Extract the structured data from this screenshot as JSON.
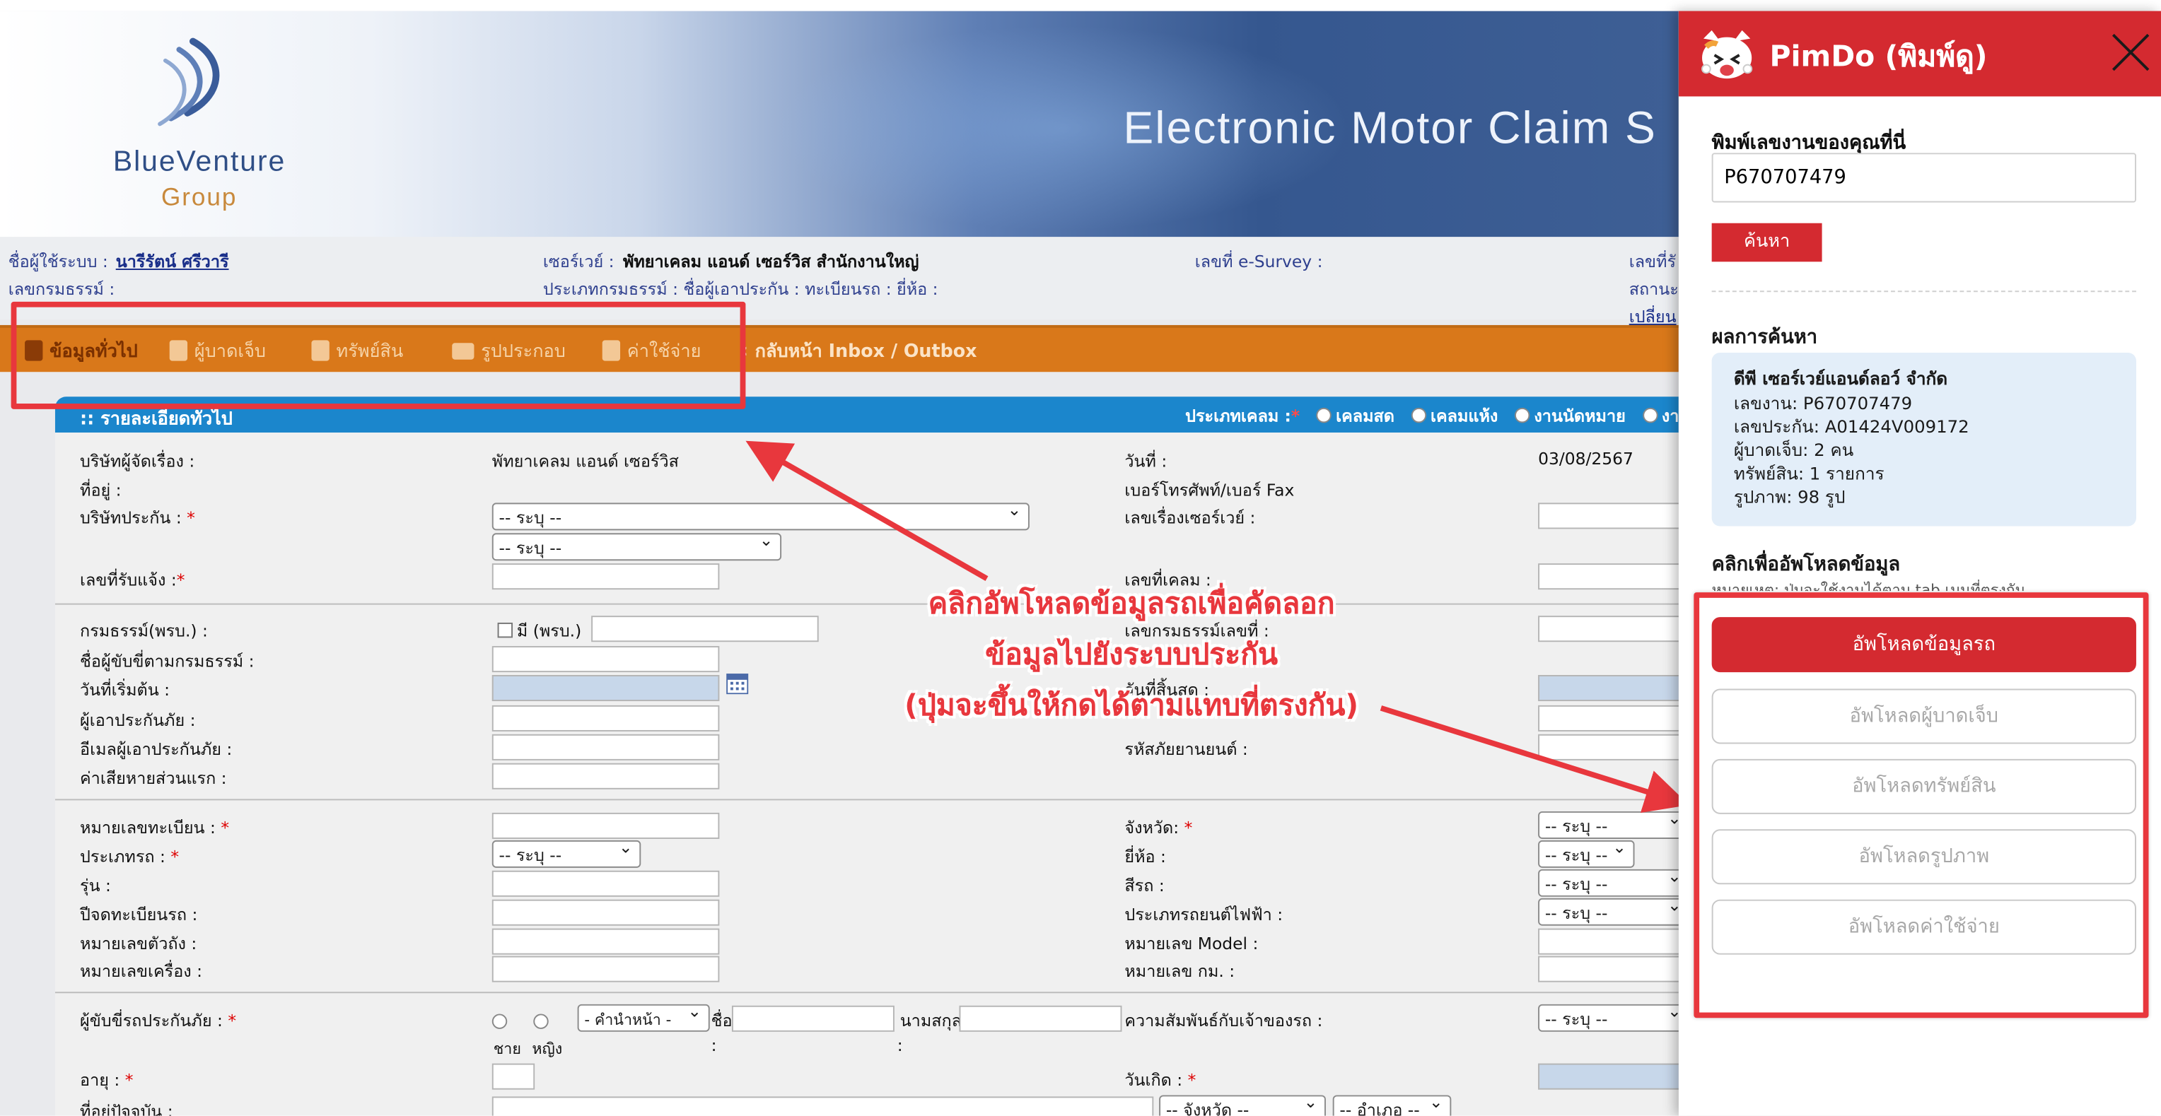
{
  "banner": {
    "company": "BlueVenture",
    "group": "Group",
    "title": "Electronic Motor Claim S"
  },
  "info": {
    "user_label": "ชื่อผู้ใช้ระบบ :",
    "user_name": "นารีรัตน์ ศรีวารี",
    "policy_no_label": "เลขกรมธรรม์ :",
    "surveyor_label": "เซอร์เวย์ :",
    "surveyor_value": "พัทยาเคลม แอนด์ เซอร์วิส สำนักงานใหญ่",
    "policy_type_line": "ประเภทกรมธรรม์ : ชื่อผู้เอาประกัน : ทะเบียนรถ : ยี่ห้อ :",
    "esurvey_label": "เลขที่ e-Survey :",
    "received_label": "เลขที่รั",
    "status_label": "สถานะ",
    "change_link": "เปลี่ยน"
  },
  "nav": [
    "ข้อมูลทั่วไป",
    "ผู้บาดเจ็บ",
    "ทรัพย์สิน",
    "รูปประกอบ",
    "ค่าใช้จ่าย",
    "กลับหน้า Inbox / Outbox"
  ],
  "panel": {
    "title": ":: รายละเอียดทั่วไป",
    "claim_type_label": "ประเภทเคลม :",
    "claim_types": [
      "เคลมสด",
      "เคลมแห้ง",
      "งานนัดหมาย",
      "งานต"
    ]
  },
  "form": {
    "company_label": "บริษัทผู้จัดเรื่อง :",
    "company_value": "พัทยาเคลม แอนด์ เซอร์วิส",
    "date_label": "วันที่ :",
    "date_value": "03/08/2567",
    "address_label": "ที่อยู่ :",
    "phone_label": "เบอร์โทรศัพท์/เบอร์ Fax",
    "insurer_label": "บริษัทประกัน :",
    "survey_no_label": "เลขเรื่องเซอร์เวย์ :",
    "select_default": "-- ระบุ --",
    "notify_no_label": "เลขที่รับแจ้ง :",
    "claim_no_label": "เลขที่เคลม :",
    "policy_label": "กรมธรรม์(พรบ.) :",
    "has_prb": "มี (พรบ.)",
    "policy_no2_label": "เลขกรมธรรม์เลขที่ :",
    "named_driver_label": "ชื่อผู้ขับขี่ตามกรมธรรม์ :",
    "start_label": "วันที่เริ่มต้น :",
    "end_label": "วันที่สิ้นสุด :",
    "insured_label": "ผู้เอาประกันภัย :",
    "email_label": "อีเมลผู้เอาประกันภัย :",
    "vehicle_code_label": "รหัสภัยยานยนต์ :",
    "deductible_label": "ค่าเสียหายส่วนแรก :",
    "plate_label": "หมายเลขทะเบียน :",
    "province_label": "จังหวัด:",
    "car_type_label": "ประเภทรถ :",
    "brand_label": "ยี่ห้อ :",
    "model_label": "รุ่น :",
    "color_label": "สีรถ :",
    "reg_year_label": "ปีจดทะเบียนรถ :",
    "ev_type_label": "ประเภทรถยนต์ไฟฟ้า :",
    "chassis_label": "หมายเลขตัวถัง :",
    "model_no_label": "หมายเลข Model :",
    "engine_label": "หมายเลขเครื่อง :",
    "km_label": "หมายเลข กม. :",
    "driver_label": "ผู้ขับขี่รถประกันภัย :",
    "male": "ชาย",
    "female": "หญิง",
    "prefix_default": "- คำนำหน้า -",
    "name_label": "ชื่อ",
    "surname_label": "นามสกุล",
    "relation_label": "ความสัมพันธ์กับเจ้าของรถ :",
    "age_label": "อายุ :",
    "birth_label": "วันเกิด :",
    "current_address_label": "ที่อยู่ปัจจุบัน :",
    "province_default": "-- จังหวัด --",
    "district_default": "-- อำเภอ --"
  },
  "callout": {
    "line1": "คลิกอัพโหลดข้อมูลรถเพื่อคัดลอก",
    "line2": "ข้อมูลไปยังระบบประกัน",
    "line3": "(ปุ่มจะขึ้นให้กดได้ตามแทบที่ตรงกัน)",
    "color": "#e8373d"
  },
  "pimdo": {
    "title": "PimDo (พิมพ์ดู)",
    "input_label": "พิมพ์เลขงานของคุณที่นี่",
    "input_value": "P670707479",
    "search_button": "ค้นหา",
    "result_heading": "ผลการค้นหา",
    "result": {
      "company": "ดีพี เซอร์เวย์แอนด์ลอว์ จำกัด",
      "job": "เลขงาน: P670707479",
      "claim": "เลขประกัน: A01424V009172",
      "injured": "ผู้บาดเจ็บ: 2 คน",
      "property": "ทรัพย์สิน: 1 รายการ",
      "photos": "รูปภาพ: 98 รูป"
    },
    "upload_heading": "คลิกเพื่ออัพโหลดข้อมูล",
    "upload_note": "หมายเหตุ: ปุ่มจะใช้งานได้ตาม tab เมนูที่ตรงกัน",
    "buttons": [
      "อัพโหลดข้อมูลรถ",
      "อัพโหลดผู้บาดเจ็บ",
      "อัพโหลดทรัพย์สิน",
      "อัพโหลดรูปภาพ",
      "อัพโหลดค่าใช้จ่าย"
    ],
    "accent": "#d42a30"
  }
}
